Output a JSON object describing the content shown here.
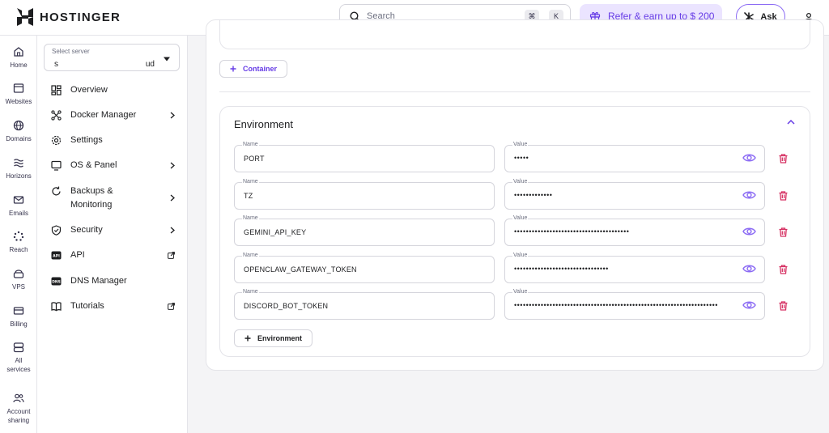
{
  "header": {
    "brand": "HOSTINGER",
    "search_placeholder": "Search",
    "shortcut_keys": [
      "⌘",
      "K"
    ],
    "refer_label": "Refer & earn up to $ 200",
    "ask_label": "Ask",
    "colors": {
      "accent": "#673de6",
      "refer_bg": "#ebe4ff"
    }
  },
  "rail": {
    "items": [
      {
        "label": "Home",
        "icon": "home-icon"
      },
      {
        "label": "Websites",
        "icon": "websites-icon"
      },
      {
        "label": "Domains",
        "icon": "globe-icon"
      },
      {
        "label": "Horizons",
        "icon": "horizons-icon"
      },
      {
        "label": "Emails",
        "icon": "mail-icon"
      },
      {
        "label": "Reach",
        "icon": "reach-icon"
      },
      {
        "label": "VPS",
        "icon": "vps-icon"
      },
      {
        "label": "Billing",
        "icon": "billing-icon"
      },
      {
        "label": "All",
        "icon": "all-services-icon"
      },
      {
        "label": "services",
        "icon": ""
      },
      {
        "label": "Account",
        "icon": "account-sharing-icon"
      },
      {
        "label": "sharing",
        "icon": ""
      }
    ]
  },
  "sidebar": {
    "select_label": "Select server",
    "select_value_start": "s",
    "select_value_end": "ud",
    "items": [
      {
        "label": "Overview",
        "icon": "overview-icon"
      },
      {
        "label": "Docker Manager",
        "icon": "docker-icon",
        "trailing": "chevron"
      },
      {
        "label": "Settings",
        "icon": "gear-icon"
      },
      {
        "label": "OS & Panel",
        "icon": "monitor-icon",
        "trailing": "chevron"
      },
      {
        "label": "Backups &",
        "label2": "Monitoring",
        "icon": "backup-icon",
        "trailing": "chevron"
      },
      {
        "label": "Security",
        "icon": "shield-icon",
        "trailing": "chevron"
      },
      {
        "label": "API",
        "icon": "api-icon",
        "trailing": "external"
      },
      {
        "label": "DNS Manager",
        "icon": "dns-icon"
      },
      {
        "label": "Tutorials",
        "icon": "book-icon",
        "trailing": "external"
      }
    ]
  },
  "main": {
    "add_container_label": "Container",
    "environment": {
      "title": "Environment",
      "name_label": "Name",
      "value_label": "Value",
      "rows": [
        {
          "name": "PORT",
          "masked": "•••••"
        },
        {
          "name": "TZ",
          "masked": "•••••••••••••"
        },
        {
          "name": "GEMINI_API_KEY",
          "masked": "•••••••••••••••••••••••••••••••••••••••"
        },
        {
          "name": "OPENCLAW_GATEWAY_TOKEN",
          "masked": "••••••••••••••••••••••••••••••••"
        },
        {
          "name": "DISCORD_BOT_TOKEN",
          "masked": "•••••••••••••••••••••••••••••••••••••••••••••••••••••••••••••••••••••"
        }
      ],
      "add_label": "Environment"
    },
    "colors": {
      "trash": "#d63163",
      "eye": "#8c6cf4"
    }
  }
}
